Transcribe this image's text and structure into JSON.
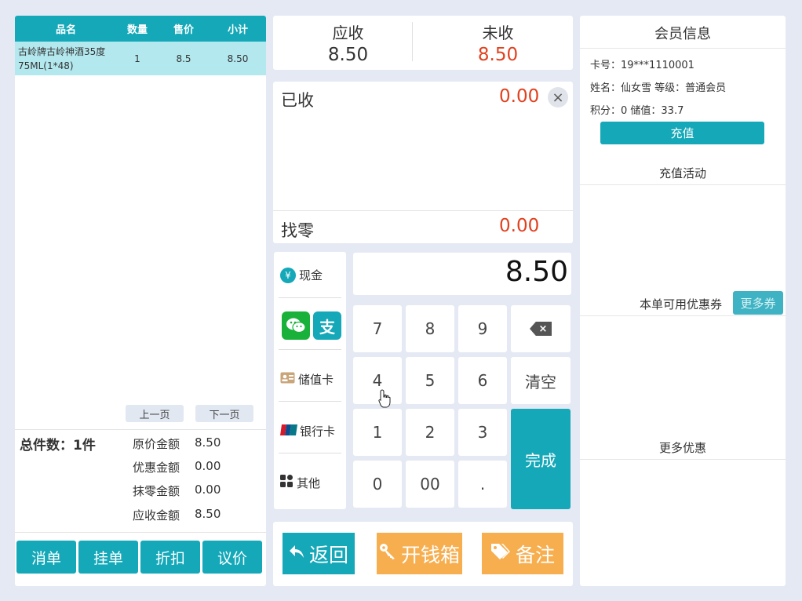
{
  "order_table": {
    "headers": [
      "品名",
      "数量",
      "售价",
      "小计"
    ],
    "rows": [
      {
        "name_line1": "古岭牌古岭神酒35度",
        "name_line2": "75ML(1*48)",
        "qty": "1",
        "price": "8.5",
        "subtotal": "8.50"
      }
    ]
  },
  "pager": {
    "prev": "上一页",
    "next": "下一页"
  },
  "summary": {
    "total_count": "总件数：1件",
    "rows": [
      {
        "label": "原价金额",
        "value": "8.50"
      },
      {
        "label": "优惠金额",
        "value": "0.00"
      },
      {
        "label": "抹零金额",
        "value": "0.00"
      },
      {
        "label": "应收金额",
        "value": "8.50"
      }
    ]
  },
  "left_buttons": [
    "消单",
    "挂单",
    "折扣",
    "议价"
  ],
  "due": {
    "receivable_label": "应收",
    "receivable_value": "8.50",
    "unpaid_label": "未收",
    "unpaid_value": "8.50"
  },
  "paid": {
    "label": "已收",
    "value": "0.00",
    "clear": "×"
  },
  "change": {
    "label": "找零",
    "value": "0.00"
  },
  "pay_methods": {
    "cash": "现金",
    "cash_icon": "¥",
    "alipay_icon": "支",
    "stored_card": "储值卡",
    "bank_card": "银行卡",
    "other": "其他"
  },
  "amount": "8.50",
  "keypad": {
    "keys": [
      "7",
      "8",
      "9",
      "4",
      "5",
      "6",
      "1",
      "2",
      "3",
      "0",
      "00",
      "."
    ],
    "backspace": "×",
    "clear": "清空",
    "done": "完成"
  },
  "actions": {
    "back": "返回",
    "cashbox": "开钱箱",
    "note": "备注"
  },
  "member": {
    "title": "会员信息",
    "card": "卡号：19***1110001",
    "name_level": "姓名：仙女雪  等级：普通会员",
    "points_balance": "积分：0  储值：33.7",
    "recharge": "充值",
    "recharge_activity": "充值活动",
    "coupon_label": "本单可用优惠券",
    "more_coupons": "更多券",
    "more_discounts": "更多优惠"
  },
  "colors": {
    "teal": "#14a8b8",
    "orange": "#f7ae4f",
    "red": "#e1401e",
    "light_teal": "#b3e8ee"
  }
}
